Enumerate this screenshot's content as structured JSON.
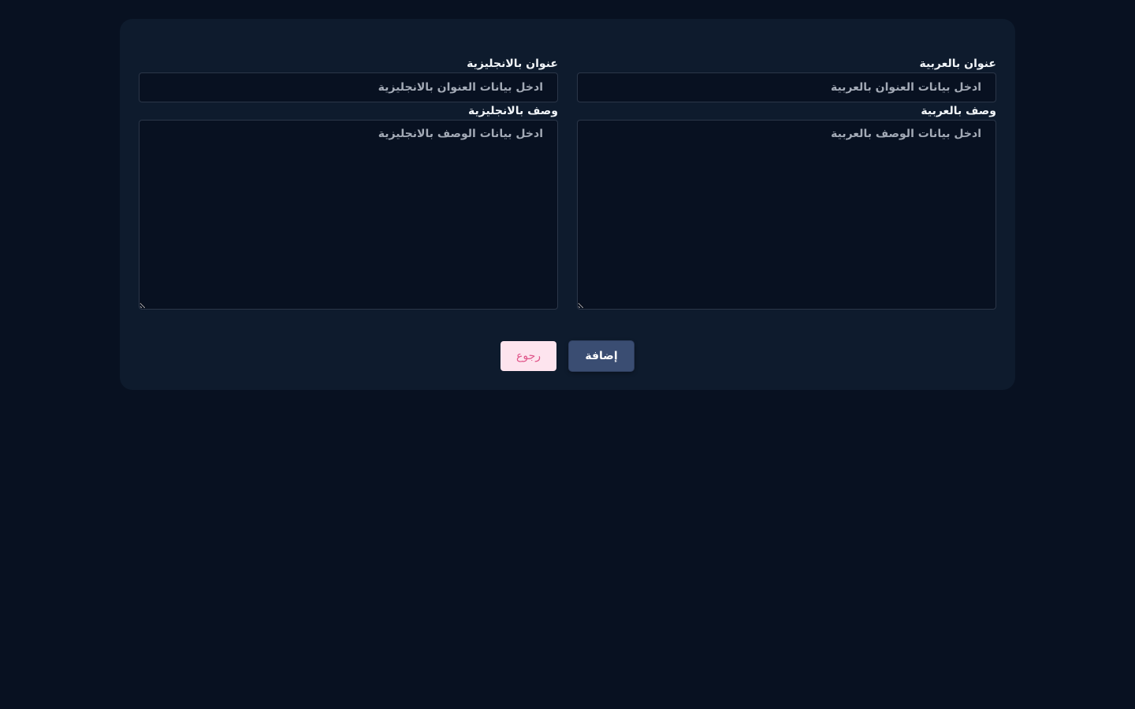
{
  "form": {
    "title_ar": {
      "label": "عنوان بالعربية",
      "placeholder": "ادخل بيانات العنوان بالعربية"
    },
    "title_en": {
      "label": "عنوان بالانجليزية",
      "placeholder": "ادخل بيانات العنوان بالانجليزية"
    },
    "desc_ar": {
      "label": "وصف بالعربية",
      "placeholder": "ادخل بيانات الوصف بالعربية"
    },
    "desc_en": {
      "label": "وصف بالانجليزية",
      "placeholder": "ادخل بيانات الوصف بالانجليزية"
    }
  },
  "actions": {
    "add_label": "إضافة",
    "back_label": "رجوع"
  },
  "colors": {
    "page_background": "#081121",
    "card_background": "#0e1b2d",
    "add_button": "#3a4d72",
    "back_button": "#fde4ee",
    "back_button_text": "#e0568a"
  }
}
